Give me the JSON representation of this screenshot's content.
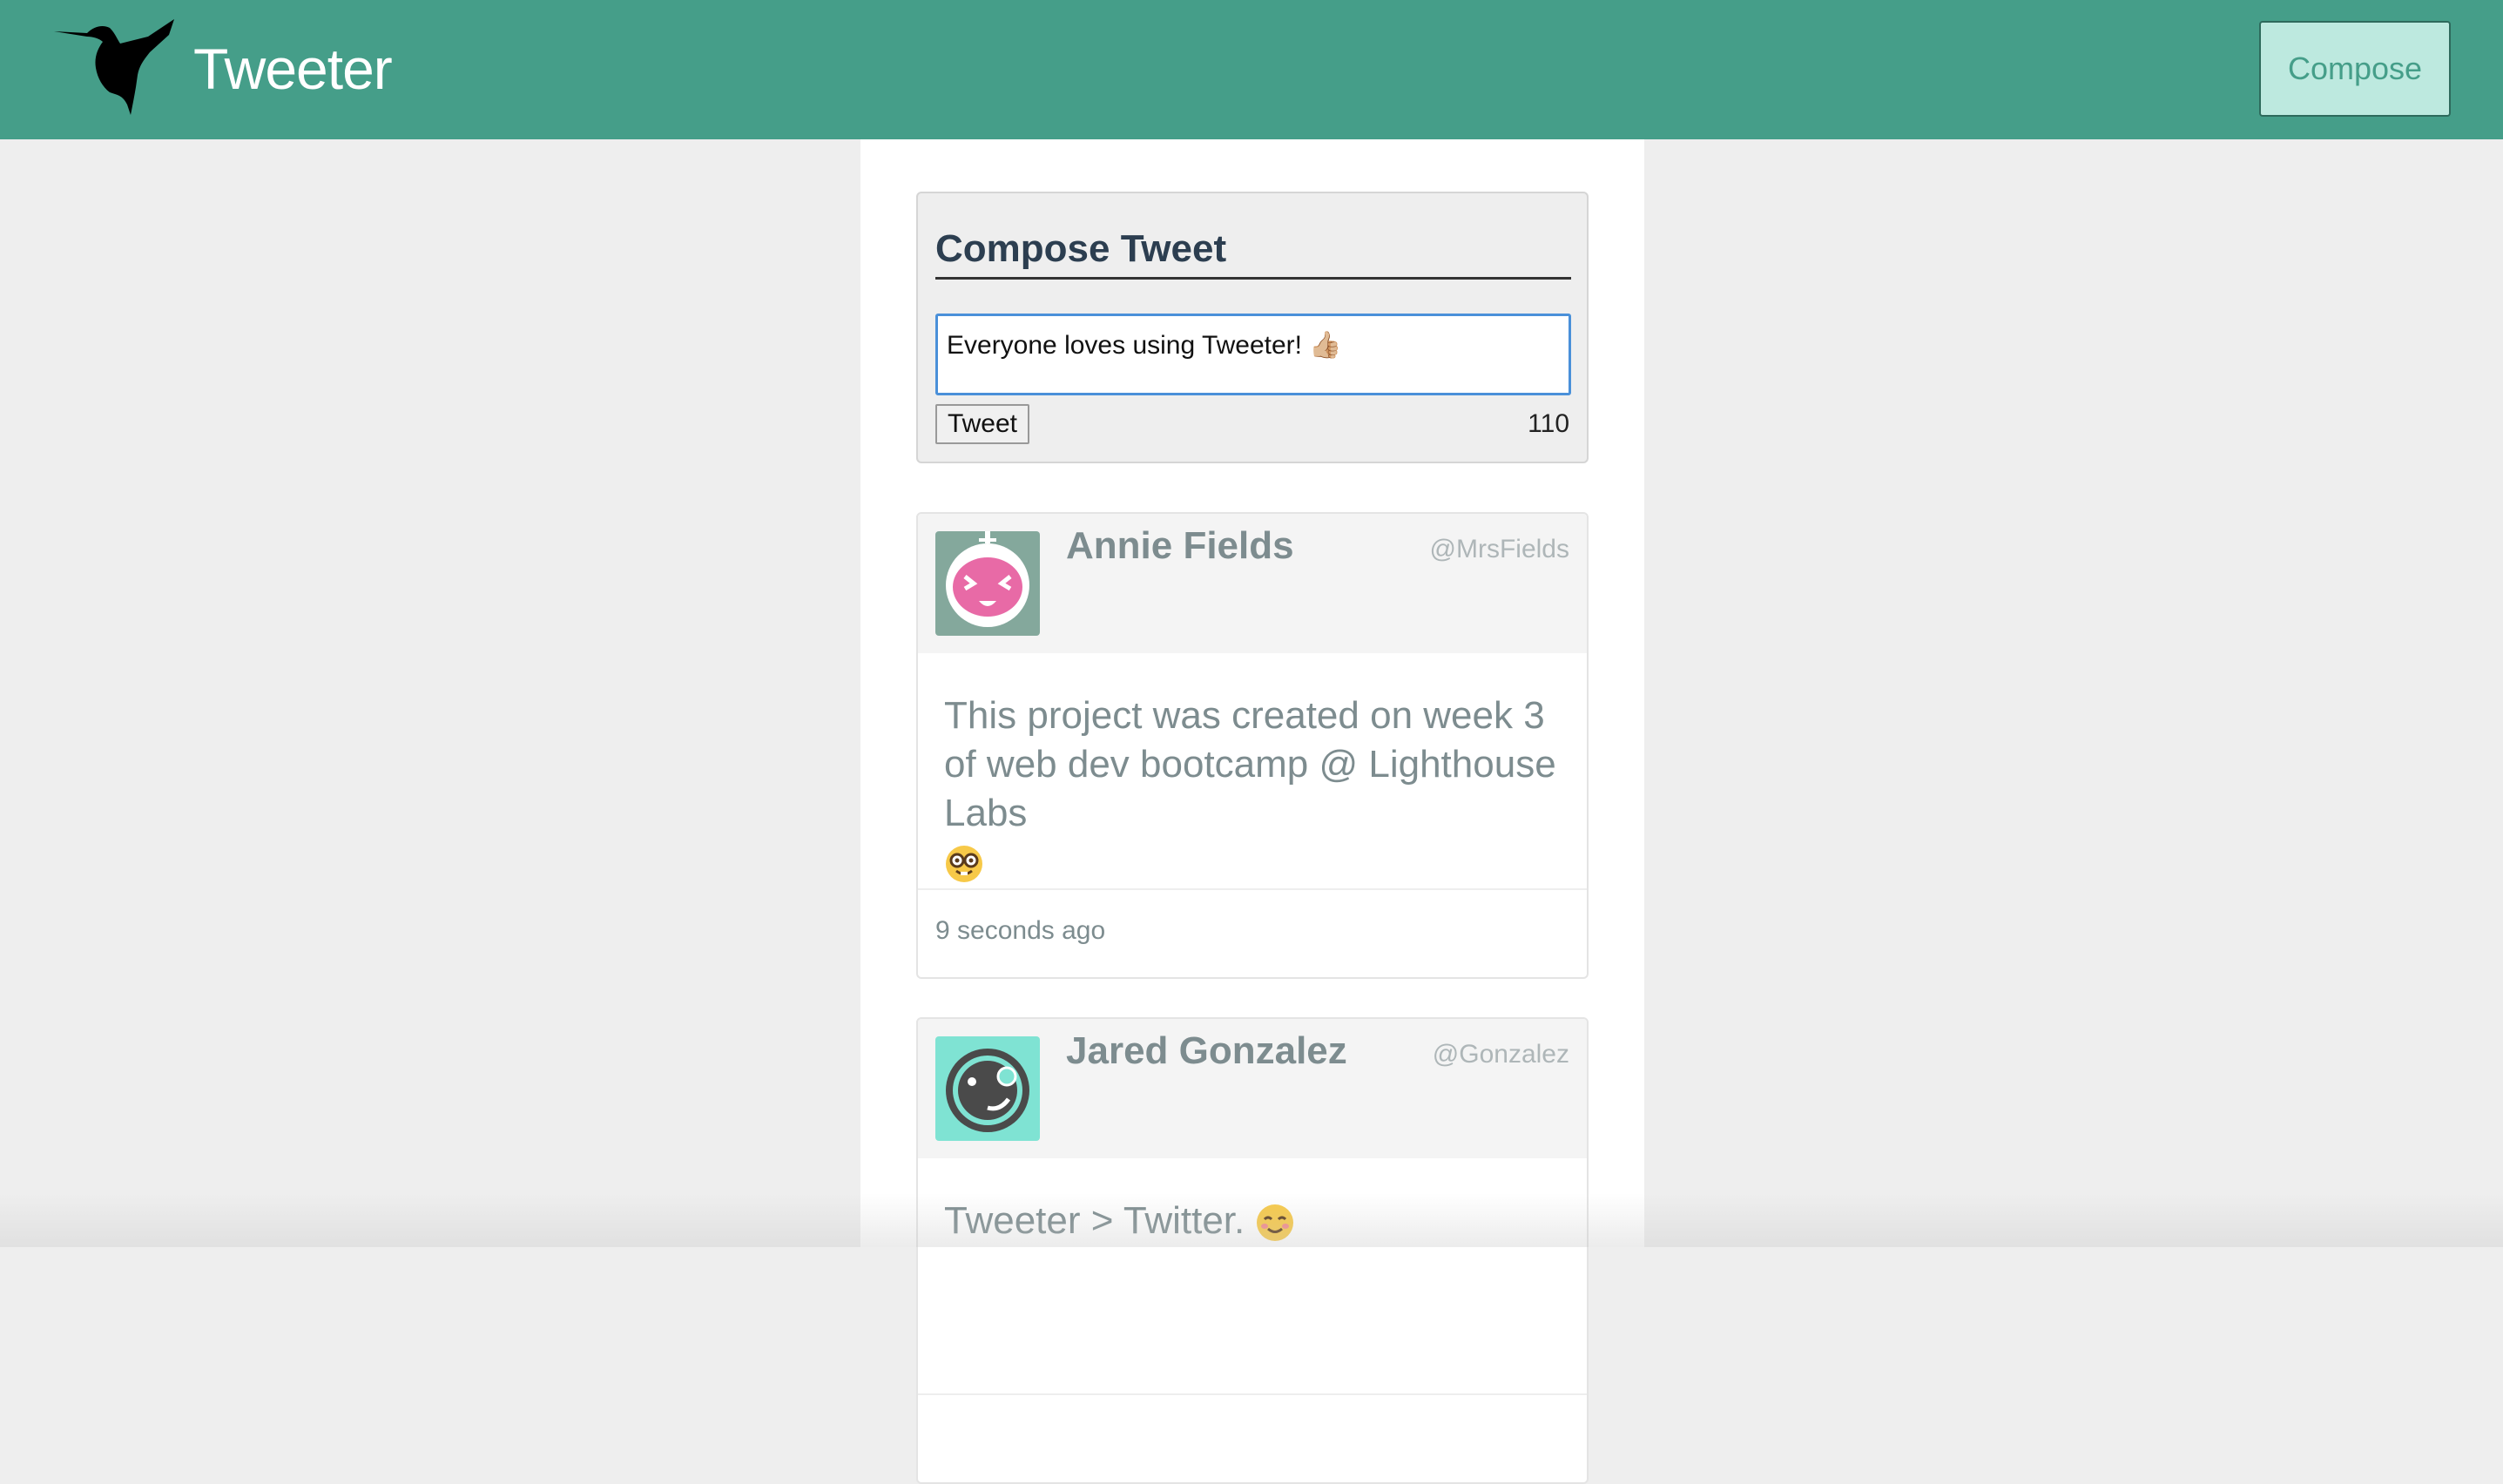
{
  "nav": {
    "brand": "Tweeter",
    "compose_label": "Compose",
    "brand_color": "#459e89"
  },
  "composer": {
    "heading": "Compose Tweet",
    "input_value": "Everyone loves using Tweeter! 👍🏼",
    "submit_label": "Tweet",
    "char_count": "110"
  },
  "tweets": [
    {
      "name": "Annie Fields",
      "handle": "@MrsFields",
      "text": "This project was created on week 3 of web dev bootcamp @ Lighthouse Labs",
      "emoji": "nerd-face",
      "timestamp": "9 seconds ago",
      "avatar": "pink-robot-face-icon",
      "avatar_bg": "#84a89c"
    },
    {
      "name": "Jared Gonzalez",
      "handle": "@Gonzalez",
      "text": "Tweeter > Twitter.",
      "emoji": "smiling-face",
      "timestamp": "",
      "avatar": "winking-monocle-face-icon",
      "avatar_bg": "#7fe3d3"
    }
  ]
}
